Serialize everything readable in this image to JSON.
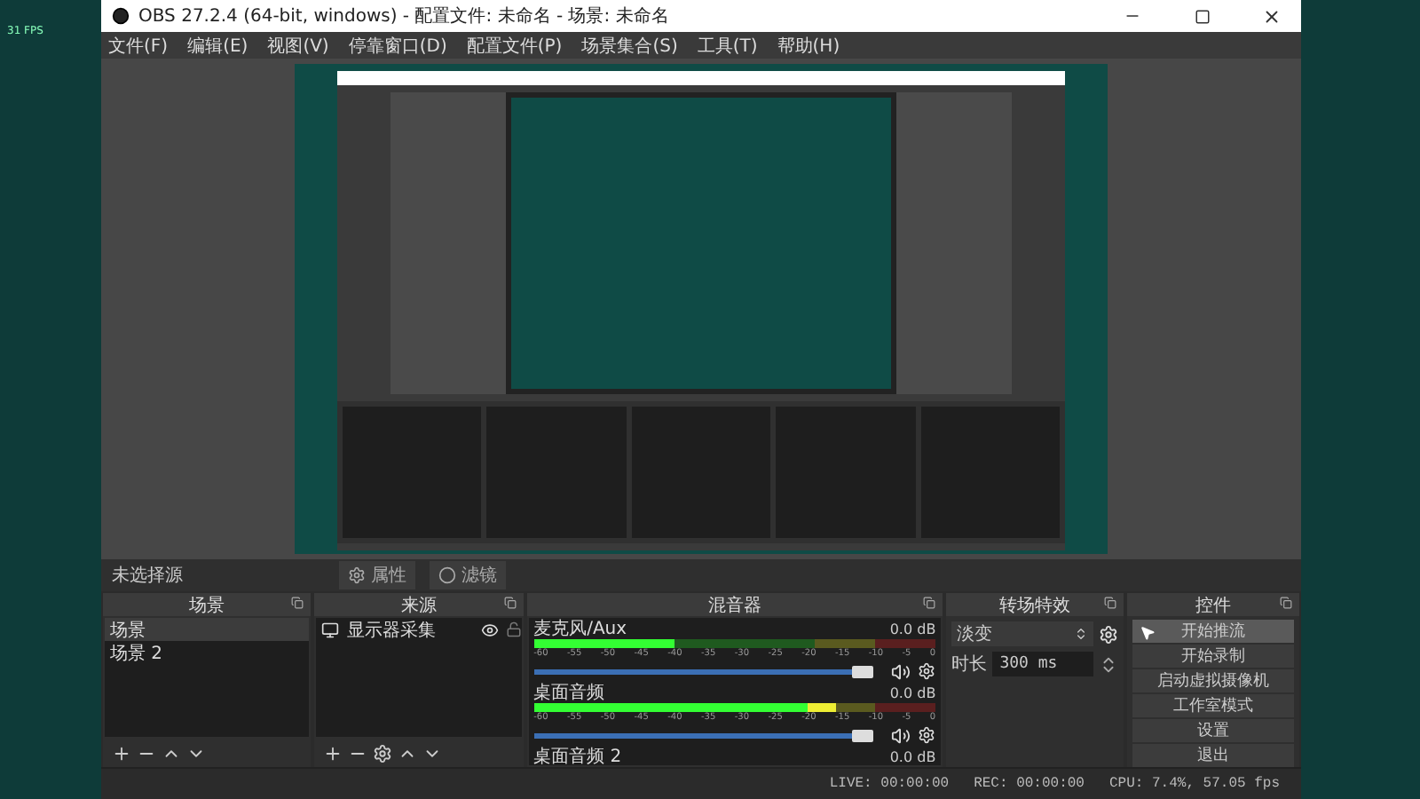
{
  "desktop": {
    "fps": "31 FPS"
  },
  "window": {
    "title": "OBS 27.2.4 (64-bit, windows) - 配置文件: 未命名 - 场景: 未命名"
  },
  "menu": [
    "文件(F)",
    "编辑(E)",
    "视图(V)",
    "停靠窗口(D)",
    "配置文件(P)",
    "场景集合(S)",
    "工具(T)",
    "帮助(H)"
  ],
  "source_bar": {
    "label": "未选择源",
    "buttons": [
      {
        "kind": "gear",
        "label": "属性"
      },
      {
        "kind": "filter",
        "label": "滤镜"
      }
    ]
  },
  "scenes": {
    "title": "场景",
    "items": [
      {
        "label": "场景",
        "selected": true
      },
      {
        "label": "场景 2",
        "selected": false
      }
    ]
  },
  "sources": {
    "title": "来源",
    "items": [
      {
        "label": "显示器采集",
        "visible": true,
        "locked": false
      }
    ]
  },
  "mixer": {
    "title": "混音器",
    "channels": [
      {
        "name": "麦克风/Aux",
        "reading": "0.0 dB",
        "level": 0.35,
        "volume": {
          "level": 0.97
        },
        "ticks": [
          "-60",
          "-55",
          "-50",
          "-45",
          "-40",
          "-35",
          "-30",
          "-25",
          "-20",
          "-15",
          "-10",
          "-5",
          "0"
        ]
      },
      {
        "name": "桌面音频",
        "reading": "0.0 dB",
        "level": 0.75,
        "volume": {
          "level": 0.97
        },
        "ticks": [
          "-60",
          "-55",
          "-50",
          "-45",
          "-40",
          "-35",
          "-30",
          "-25",
          "-20",
          "-15",
          "-10",
          "-5",
          "0"
        ]
      },
      {
        "name": "桌面音频 2",
        "reading": "0.0 dB"
      }
    ]
  },
  "transitions": {
    "title": "转场特效",
    "selected": "淡变",
    "duration_label": "时长",
    "duration": "300 ms"
  },
  "controls": {
    "title": "控件",
    "buttons": [
      {
        "label": "开始推流",
        "hovered": true
      },
      {
        "label": "开始录制",
        "hovered": false
      },
      {
        "label": "启动虚拟摄像机",
        "hovered": false
      },
      {
        "label": "工作室模式",
        "hovered": false
      },
      {
        "label": "设置",
        "hovered": false
      },
      {
        "label": "退出",
        "hovered": false
      }
    ]
  },
  "status_bar": {
    "live": "LIVE: 00:00:00",
    "rec": "REC: 00:00:00",
    "cpu": "CPU: 7.4%, 57.05 fps"
  }
}
